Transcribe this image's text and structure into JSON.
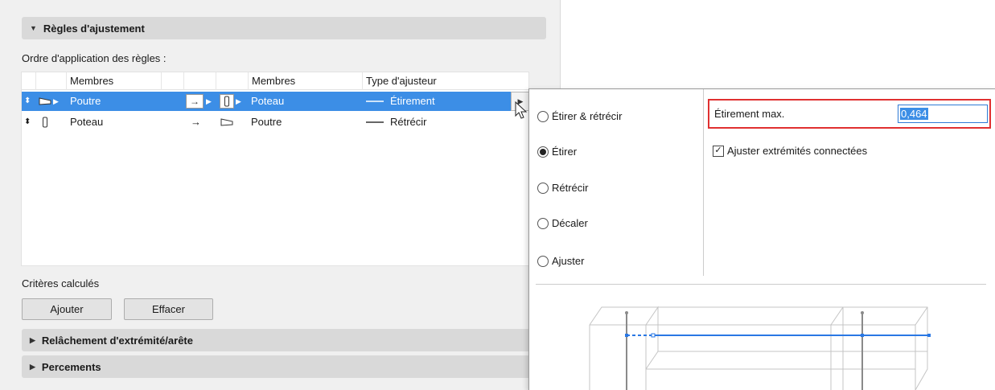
{
  "sections": {
    "adjust_rules": "Règles d'ajustement",
    "release": "Relâchement d'extrémité/arête",
    "percements": "Percements"
  },
  "order_label": "Ordre d'application des règles :",
  "table": {
    "headers": {
      "members_1": "Membres",
      "members_2": "Membres",
      "type": "Type d'ajusteur"
    },
    "rows": [
      {
        "member_1": "Poutre",
        "member_2": "Poteau",
        "type": "Étirement",
        "selected": true
      },
      {
        "member_1": "Poteau",
        "member_2": "Poutre",
        "type": "Rétrécir",
        "selected": false
      }
    ]
  },
  "computed_label": "Critères calculés",
  "buttons": {
    "add": "Ajouter",
    "clear": "Effacer"
  },
  "popover": {
    "options": [
      "Étirer & rétrécir",
      "Étirer",
      "Rétrécir",
      "Décaler",
      "Ajuster"
    ],
    "selected_option": "Étirer",
    "max_stretch_label": "Étirement max.",
    "max_stretch_value": "0,464",
    "adjust_ends_label": "Ajuster extrémités connectées",
    "adjust_ends_checked": true
  },
  "colors": {
    "selection": "#3c8ee6",
    "highlight_border": "#e03030",
    "preview_line": "#2a78e4"
  }
}
